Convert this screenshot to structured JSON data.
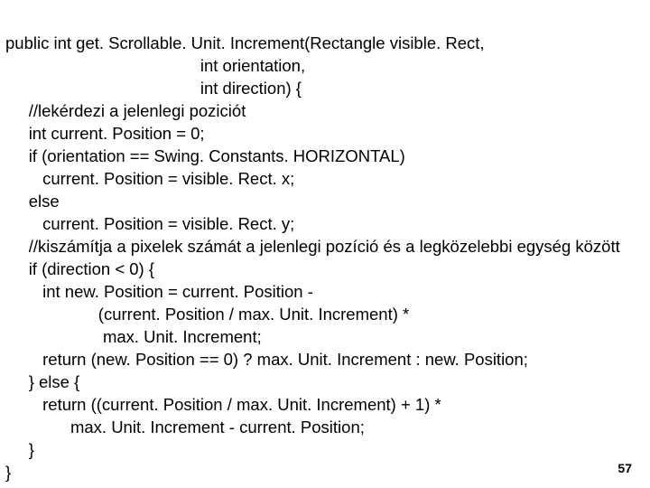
{
  "code": {
    "line1": "public int get. Scrollable. Unit. Increment(Rectangle visible. Rect,",
    "line2": "                                          int orientation,",
    "line3": "                                          int direction) {",
    "line4": "     //lekérdezi a jelenlegi poziciót",
    "line5": "     int current. Position = 0;",
    "line6": "     if (orientation == Swing. Constants. HORIZONTAL)",
    "line7": "        current. Position = visible. Rect. x;",
    "line8": "     else",
    "line9": "        current. Position = visible. Rect. y;",
    "line10": "     //kiszámítja a pixelek számát a jelenlegi pozíció és a legközelebbi egység között",
    "line11": "     if (direction < 0) {",
    "line12": "        int new. Position = current. Position -",
    "line13": "                    (current. Position / max. Unit. Increment) *",
    "line14": "                     max. Unit. Increment;",
    "line15": "        return (new. Position == 0) ? max. Unit. Increment : new. Position;",
    "line16": "     } else {",
    "line17": "        return ((current. Position / max. Unit. Increment) + 1) *",
    "line18": "              max. Unit. Increment - current. Position;",
    "line19": "     }",
    "line20": "}"
  },
  "page_number": "57"
}
